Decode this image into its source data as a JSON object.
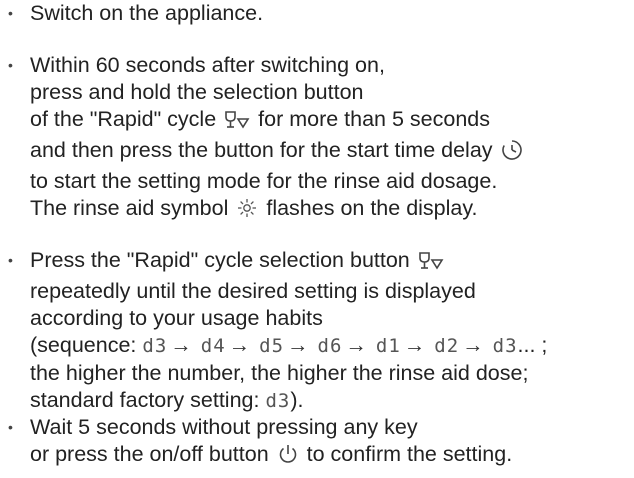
{
  "steps": [
    {
      "lines": [
        "Switch on the appliance."
      ]
    },
    {
      "lines": [
        "Within 60 seconds after switching on,",
        "press and hold the selection button",
        "of the \"Rapid\" cycle",
        "for more than 5 seconds",
        "and then press the button for the start time delay",
        "to start the setting mode for the rinse aid dosage.",
        "The rinse aid symbol",
        "flashes on the display."
      ]
    },
    {
      "lines": [
        "Press the \"Rapid\" cycle selection button",
        "repeatedly until the desired setting is displayed",
        "according to your usage habits",
        "(sequence:",
        "... ;",
        "the higher the number, the higher the rinse aid dose;",
        "standard factory setting:",
        ")."
      ]
    },
    {
      "lines": [
        "Wait 5 seconds without pressing any key",
        "or press the on/off button",
        "to confirm the setting."
      ]
    }
  ],
  "sequence": [
    "d3",
    "d4",
    "d5",
    "d6",
    "d1",
    "d2",
    "d3"
  ],
  "default_setting": "d3",
  "icons": {
    "rapid": "glass-rapid-icon",
    "delay": "clock-delay-icon",
    "rinse_aid": "rinse-aid-sun-icon",
    "power": "power-icon"
  },
  "bullet": "•"
}
